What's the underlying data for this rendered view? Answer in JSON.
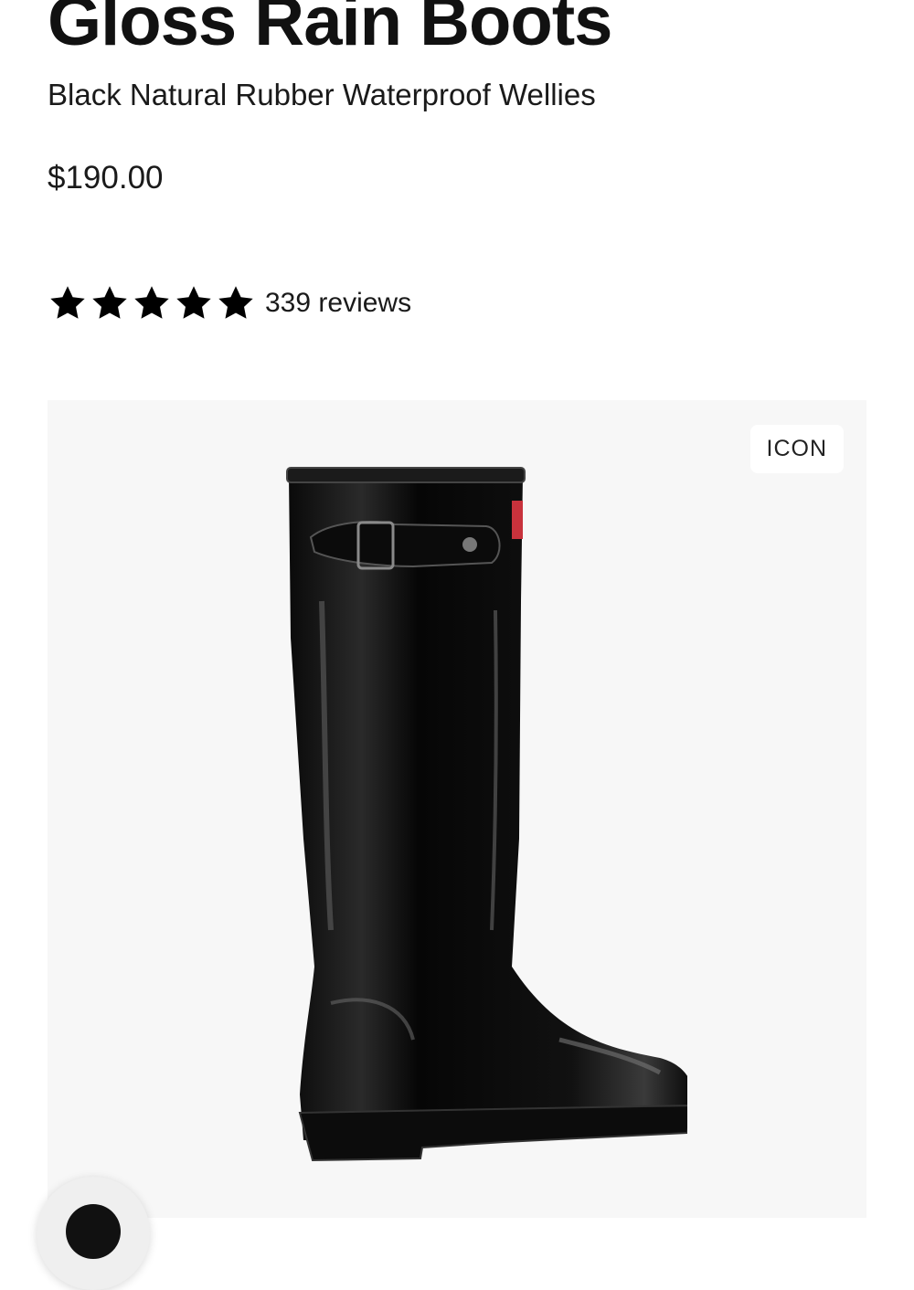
{
  "product": {
    "title": "Gloss Rain Boots",
    "subtitle": "Black Natural Rubber Waterproof Wellies",
    "price": "$190.00",
    "rating": {
      "stars_filled": 5,
      "stars_total": 5,
      "review_count_label": "339 reviews"
    }
  },
  "gallery": {
    "badge_label": "ICON",
    "image_icon": "rain-boot-image",
    "background_color": "#f7f7f7"
  },
  "floating_button": {
    "icon": "chat-icon"
  },
  "colors": {
    "text": "#111111",
    "star": "#000000"
  }
}
